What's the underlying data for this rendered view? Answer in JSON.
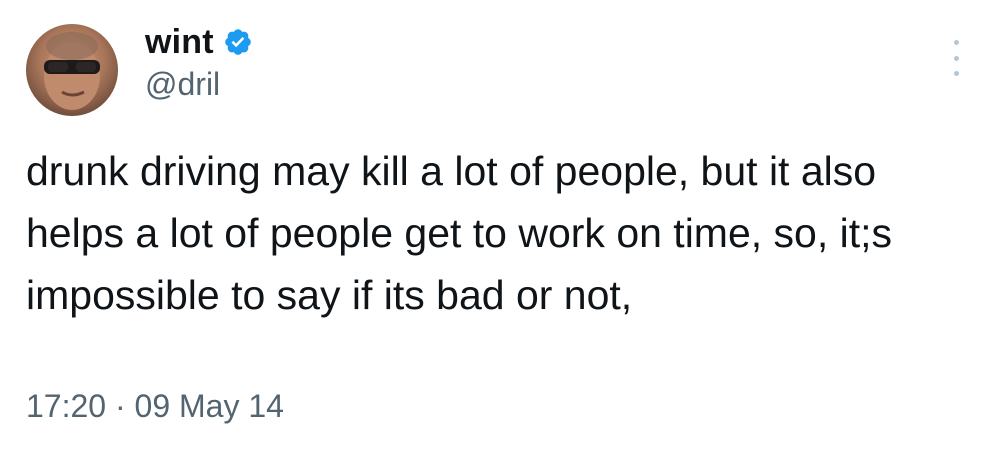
{
  "author": {
    "display_name": "wint",
    "handle": "@dril",
    "verified": true,
    "avatar_icon": "avatar-sunglasses-photo"
  },
  "tweet": {
    "text": "drunk driving may kill a lot of people, but it also helps a lot of people get to work on time, so, it;s impossible to say if its bad or not,",
    "timestamp": "17:20 · 09 May 14"
  },
  "icons": {
    "verified": "verified-badge-icon",
    "more": "more-options-icon"
  },
  "colors": {
    "text_primary": "#0f1419",
    "text_secondary": "#536471",
    "verified_blue": "#1d9bf0",
    "more_dots": "#b4c6d4",
    "background": "#ffffff"
  }
}
